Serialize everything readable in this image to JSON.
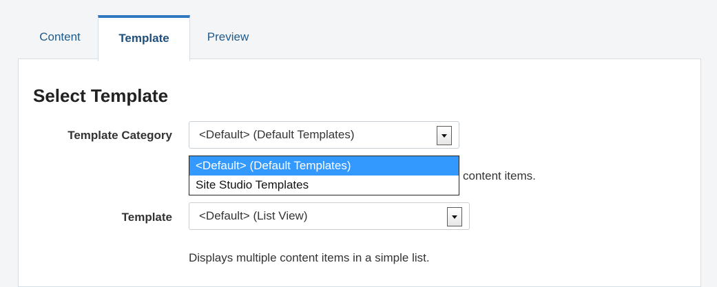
{
  "tabs": [
    {
      "label": "Content"
    },
    {
      "label": "Template"
    },
    {
      "label": "Preview"
    }
  ],
  "panel": {
    "title": "Select Template",
    "category": {
      "label": "Template Category",
      "value": "<Default> (Default Templates)",
      "options": [
        "<Default> (Default Templates)",
        "Site Studio Templates"
      ],
      "helper_visible_tail": "content items."
    },
    "template": {
      "label": "Template",
      "value": "<Default> (List View)",
      "description": "Displays multiple content items in a simple list."
    }
  },
  "icons": {
    "dropdown_arrow": "chevron-down-icon"
  },
  "colors": {
    "accent": "#2e78c2",
    "option_highlight": "#3399ff",
    "tab_text": "#1f5a8a"
  }
}
